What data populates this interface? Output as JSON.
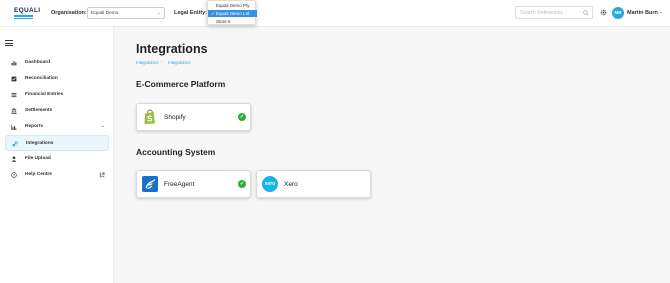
{
  "header": {
    "logo_text": "EQUALI",
    "organisation_label": "Organisation:",
    "organisation_value": "Equali Demo",
    "legal_entity_label": "Legal Entity:",
    "legal_entity_options": [
      "Equali Demo Pty",
      "Equali Demo Ltd",
      "Store 6"
    ],
    "legal_entity_selected_index": 1,
    "search_placeholder": "Search References",
    "user_initials": "MB",
    "user_name": "Martin Burn"
  },
  "sidebar": {
    "items": [
      {
        "label": "Dashboard",
        "icon": "bar-chart-icon",
        "active": false
      },
      {
        "label": "Reconciliation",
        "icon": "checkbox-icon",
        "active": false
      },
      {
        "label": "Financial Entries",
        "icon": "list-icon",
        "active": false
      },
      {
        "label": "Settlements",
        "icon": "bank-icon",
        "active": false
      },
      {
        "label": "Reports",
        "icon": "reports-chart-icon",
        "active": false,
        "expandable": true
      },
      {
        "label": "Integrations",
        "icon": "integrations-icon",
        "active": true
      },
      {
        "label": "File Upload",
        "icon": "upload-icon",
        "active": false
      },
      {
        "label": "Help Centre",
        "icon": "help-icon",
        "active": false,
        "external": true
      }
    ]
  },
  "main": {
    "title": "Integrations",
    "breadcrumb": [
      "Integrations",
      "Integrations"
    ],
    "sections": [
      {
        "title": "E-Commerce Platform",
        "cards": [
          {
            "label": "Shopify",
            "icon": "shopify-icon",
            "connected": true
          }
        ]
      },
      {
        "title": "Accounting System",
        "cards": [
          {
            "label": "FreeAgent",
            "icon": "freeagent-icon",
            "connected": true
          },
          {
            "label": "Xero",
            "icon": "xero-icon",
            "logo_text": "xero",
            "connected": false
          }
        ]
      }
    ]
  },
  "colors": {
    "accent": "#27a8e0",
    "success": "#27ae43",
    "shopify": "#95bf47",
    "freeagent": "#1a6fc9",
    "xero": "#13b5ea",
    "dropdown_selected": "#3b8fe0"
  }
}
